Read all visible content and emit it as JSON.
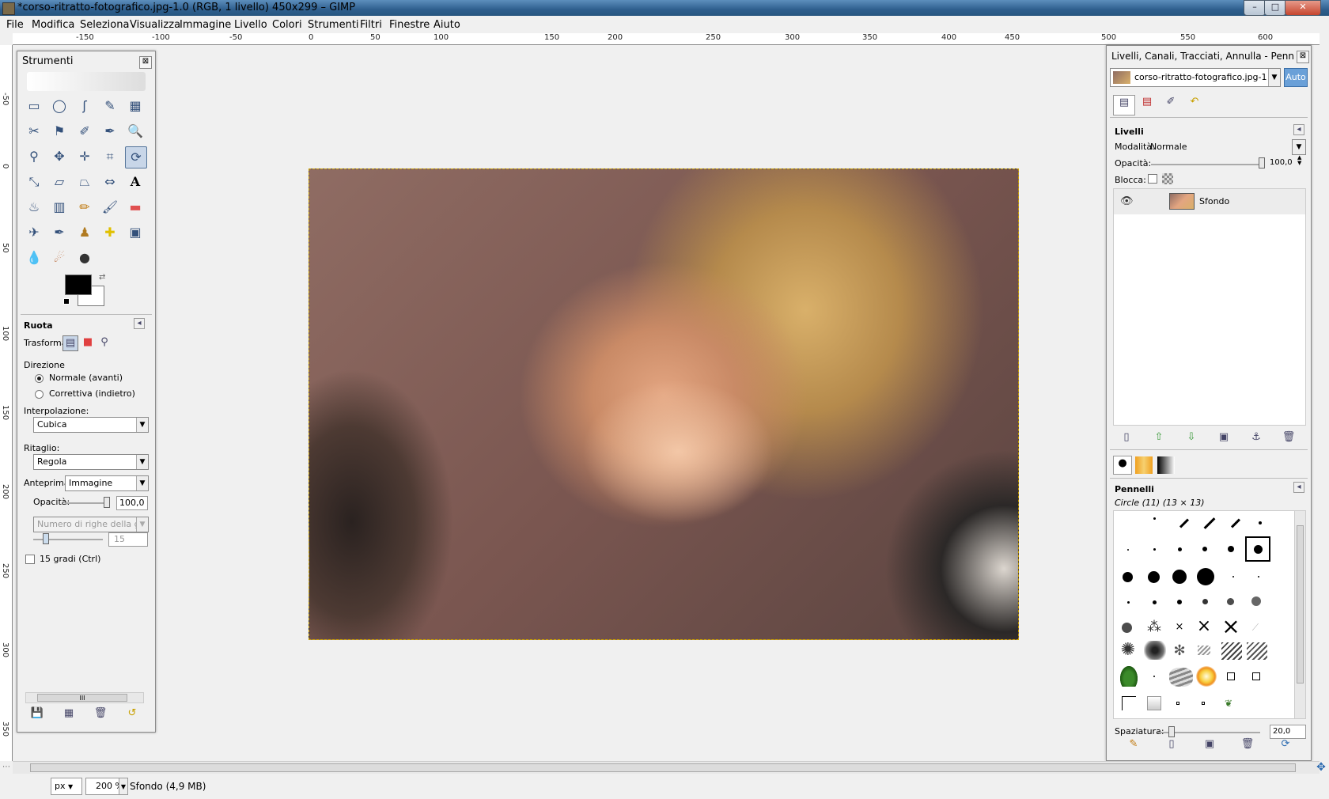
{
  "window": {
    "title": "*corso-ritratto-fotografico.jpg-1.0 (RGB, 1 livello) 450x299 – GIMP",
    "minimize": "–",
    "maximize": "□",
    "close": "✕"
  },
  "menubar": {
    "items": [
      "File",
      "Modifica",
      "Seleziona",
      "Visualizza",
      "Immagine",
      "Livello",
      "Colori",
      "Strumenti",
      "Filtri",
      "Finestre",
      "Aiuto"
    ]
  },
  "ruler": {
    "h_ticks": [
      "-150",
      "-100",
      "-50",
      "0",
      "50",
      "100",
      "150",
      "200",
      "250",
      "300",
      "350",
      "400",
      "450",
      "500",
      "550",
      "600"
    ],
    "v_ticks": [
      "-50",
      "0",
      "50",
      "100",
      "150",
      "200",
      "250",
      "300",
      "350"
    ]
  },
  "toolbox": {
    "title": "Strumenti",
    "close": "⊠",
    "tools": [
      [
        "rect-select",
        "ellipse-select",
        "free-select",
        "fuzzy-select",
        "select-by-color"
      ],
      [
        "scissors",
        "foreground-select",
        "paths",
        "color-picker",
        "zoom"
      ],
      [
        "measure",
        "move",
        "align",
        "crop",
        "rotate"
      ],
      [
        "scale",
        "shear",
        "perspective",
        "flip",
        "text"
      ],
      [
        "bucket-fill",
        "blend",
        "pencil",
        "paintbrush",
        "eraser"
      ],
      [
        "airbrush",
        "ink",
        "clone",
        "heal",
        "perspective-clone"
      ],
      [
        "blur",
        "smudge",
        "dodge-burn"
      ]
    ],
    "tool_glyphs": [
      [
        "▭",
        "◯",
        "ʃ",
        "✎",
        "▦"
      ],
      [
        "✂",
        "⚑",
        "✐",
        "✒",
        "🔍"
      ],
      [
        "⚲",
        "✥",
        "✛",
        "⌗",
        "⟳"
      ],
      [
        "⤡",
        "▱",
        "⏢",
        "⇔",
        "A"
      ],
      [
        "♨",
        "▥",
        "✏",
        "🖌",
        "▬"
      ],
      [
        "✈",
        "✒",
        "♟",
        "✚",
        "▣"
      ],
      [
        "💧",
        "☄",
        "●"
      ]
    ],
    "options": {
      "tool_name": "Ruota",
      "transform_label": "Trasforma:",
      "direction_label": "Direzione",
      "direction_normal": "Normale (avanti)",
      "direction_corrective": "Correttiva (indietro)",
      "interpolation_label": "Interpolazione:",
      "interpolation_value": "Cubica",
      "clipping_label": "Ritaglio:",
      "clipping_value": "Regola",
      "preview_label": "Anteprima:",
      "preview_value": "Immagine",
      "opacity_label": "Opacità:",
      "opacity_value": "100,0",
      "grid_lines_value": "Numero di righe della griglia",
      "grid_count_value": "15",
      "constrain_label": "15 gradi  (Ctrl)",
      "scroll_grip": "III"
    }
  },
  "layers_dock": {
    "title": "Livelli, Canali, Tracciati, Annulla - Pennelli, ...",
    "close": "⊠",
    "image_selector": "corso-ritratto-fotografico.jpg-1",
    "auto_button": "Auto",
    "section_title": "Livelli",
    "mode_label": "Modalità:",
    "mode_value": "Normale",
    "opacity_label": "Opacità:",
    "opacity_value": "100,0",
    "lock_label": "Blocca:",
    "layers": [
      {
        "name": "Sfondo",
        "visible": true
      }
    ]
  },
  "brushes_dock": {
    "section_title": "Pennelli",
    "current_brush": "Circle (11) (13 × 13)",
    "spacing_label": "Spaziatura:",
    "spacing_value": "20,0"
  },
  "statusbar": {
    "unit": "px",
    "zoom": "200 %",
    "info": "Sfondo (4,9 MB)"
  },
  "colors": {
    "foreground": "#000000",
    "background": "#ffffff",
    "selection_border": "#c8a000"
  }
}
